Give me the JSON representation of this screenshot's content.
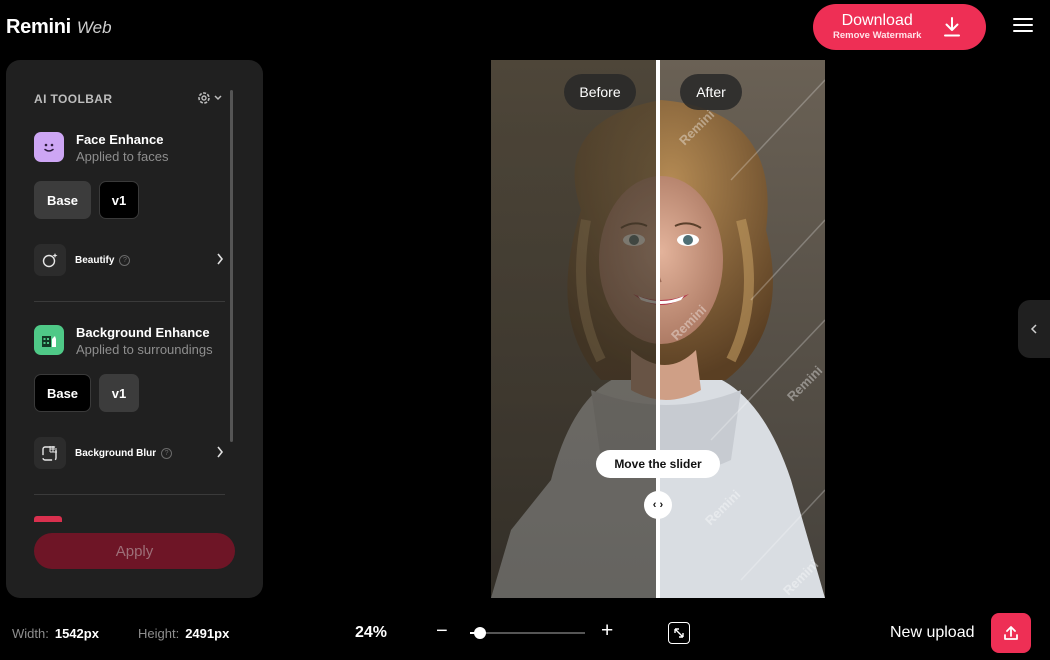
{
  "header": {
    "brand": "Remini",
    "brand_sub": "Web",
    "download_label": "Download",
    "download_sub": "Remove Watermark",
    "accent": "#ee2f55"
  },
  "toolbar": {
    "title": "AI TOOLBAR",
    "face": {
      "name": "Face Enhance",
      "desc": "Applied to faces",
      "models": [
        "Base",
        "v1"
      ],
      "selected": "Base",
      "sub_label": "Beautify"
    },
    "background": {
      "name": "Background Enhance",
      "desc": "Applied to surroundings",
      "models": [
        "Base",
        "v1"
      ],
      "selected": "v1",
      "sub_label": "Background Blur"
    },
    "apply_label": "Apply"
  },
  "compare": {
    "before_label": "Before",
    "after_label": "After",
    "hint": "Move the slider",
    "handle_glyph": "‹ ›",
    "watermark": "Remini",
    "slider_position": 0.5
  },
  "status": {
    "width_label": "Width:",
    "width_value": "1542px",
    "height_label": "Height:",
    "height_value": "2491px",
    "zoom": "24%",
    "zoom_level": 0.09,
    "new_upload": "New upload"
  },
  "icons": {
    "download": "download-icon",
    "menu": "hamburger-menu-icon",
    "settings": "gear-icon",
    "face": "smiley-face-icon",
    "background": "building-icon",
    "beautify": "sparkle-apple-icon",
    "blur": "grid-blur-icon",
    "collapse": "chevron-left-icon",
    "fit": "expand-icon",
    "upload": "upload-icon"
  }
}
